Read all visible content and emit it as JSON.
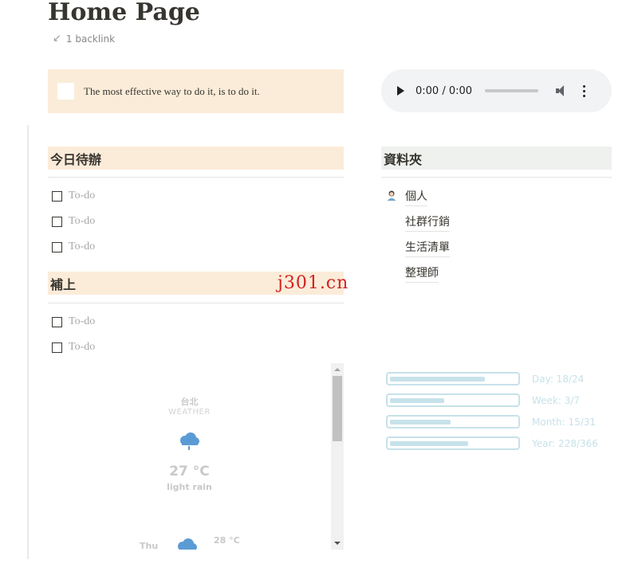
{
  "page": {
    "title": "Home Page",
    "backlink_arrow": "↙",
    "backlink": "1 backlink"
  },
  "quote": {
    "text": "The most effective way to do it, is to do it."
  },
  "audio": {
    "time": "0:00 / 0:00"
  },
  "todo_section": {
    "title": "今日待辦",
    "items": [
      "To-do",
      "To-do",
      "To-do"
    ]
  },
  "catchup_section": {
    "title": "補上",
    "items": [
      "To-do",
      "To-do"
    ]
  },
  "folders": {
    "title": "資料夾",
    "items": [
      "個人",
      "社群行銷",
      "生活清單",
      "整理師"
    ]
  },
  "watermark": "j301.cn",
  "weather": {
    "city": "台北",
    "label": "WEATHER",
    "temperature": "27 °C",
    "condition": "light rain",
    "forecast_day": "Thu",
    "forecast_high": "28 °C"
  },
  "progress": [
    {
      "label": "Day: 18/24",
      "fraction": 0.75
    },
    {
      "label": "Week: 3/7",
      "fraction": 0.4286
    },
    {
      "label": "Month: 15/31",
      "fraction": 0.4839
    },
    {
      "label": "Year: 228/366",
      "fraction": 0.623
    }
  ],
  "colors": {
    "heading_orange": "#fbecd9",
    "heading_gray": "#eef1ee",
    "progress_accent": "#c7e2ea",
    "weather_icon": "#5b9bd5"
  }
}
